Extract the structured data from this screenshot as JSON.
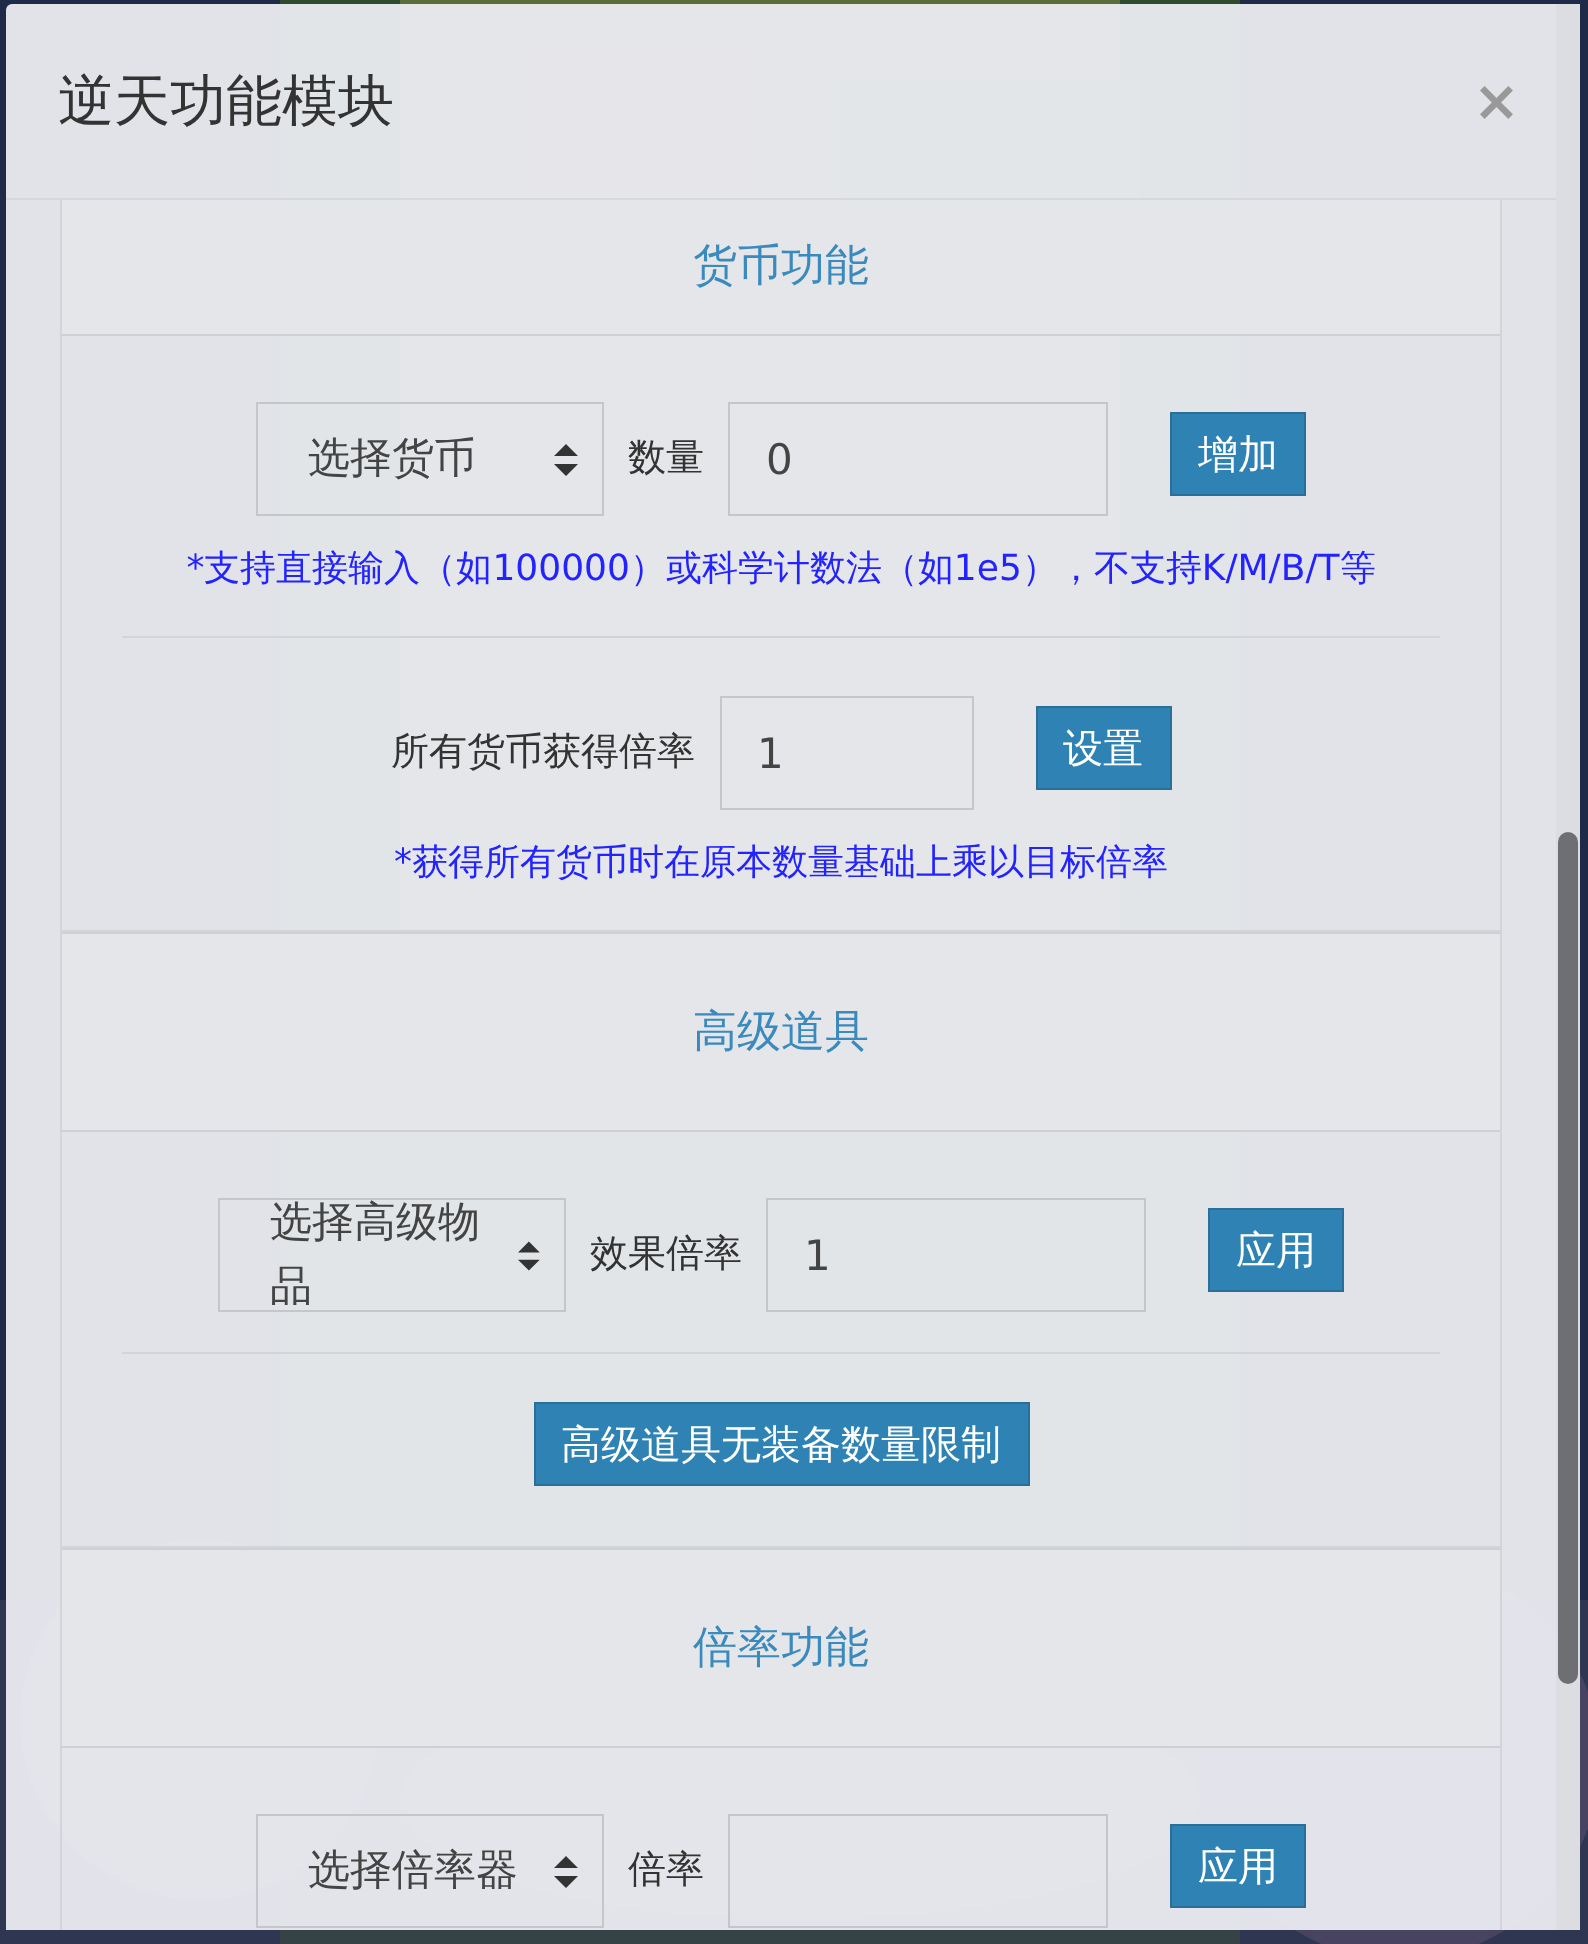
{
  "modal": {
    "title": "逆天功能模块",
    "close": "×"
  },
  "sections": [
    {
      "title": "货币功能",
      "groups": [
        {
          "kind": "select_row",
          "select": "选择货币",
          "label": "数量",
          "value": "0",
          "button": "增加",
          "hint": "*支持直接输入（如100000）或科学计数法（如1e5），不支持K/M/B/T等"
        },
        {
          "kind": "input_row",
          "label": "所有货币获得倍率",
          "value": "1",
          "button": "设置",
          "hint": "*获得所有货币时在原本数量基础上乘以目标倍率"
        }
      ]
    },
    {
      "title": "高级道具",
      "groups": [
        {
          "kind": "select_row",
          "select": "选择高级物品",
          "label": "效果倍率",
          "value": "1",
          "button": "应用"
        },
        {
          "kind": "button_row",
          "button": "高级道具无装备数量限制"
        }
      ]
    },
    {
      "title": "倍率功能",
      "groups": [
        {
          "kind": "select_row",
          "select": "选择倍率器",
          "label": "倍率",
          "button": "应用"
        }
      ]
    }
  ]
}
